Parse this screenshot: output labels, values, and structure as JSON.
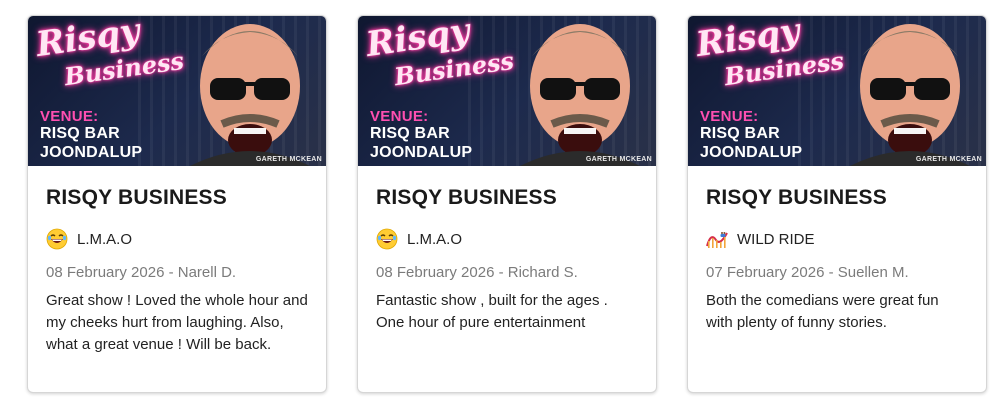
{
  "banner": {
    "logo_line1": "Risqy",
    "logo_line2": "Business",
    "venue_label": "VENUE:",
    "venue_line1": "RISQ BAR",
    "venue_line2": "JOONDALUP",
    "artist": "GARETH MCKEAN"
  },
  "reviews": [
    {
      "title": "RISQY BUSINESS",
      "rating_icon": "laughing-face-icon",
      "rating_label": "L.M.A.O",
      "meta": "08 February 2026 - Narell D.",
      "text": "Great show ! Loved the whole hour and my cheeks hurt from laughing. Also, what a great venue ! Will be back."
    },
    {
      "title": "RISQY BUSINESS",
      "rating_icon": "laughing-face-icon",
      "rating_label": "L.M.A.O",
      "meta": "08 February 2026 - Richard S.",
      "text": "Fantastic show , built for the ages . One hour of pure entertainment"
    },
    {
      "title": "RISQY BUSINESS",
      "rating_icon": "roller-coaster-icon",
      "rating_label": "WILD RIDE",
      "meta": "07 February 2026 - Suellen M.",
      "text": "Both the comedians were great fun with plenty of funny stories."
    }
  ]
}
